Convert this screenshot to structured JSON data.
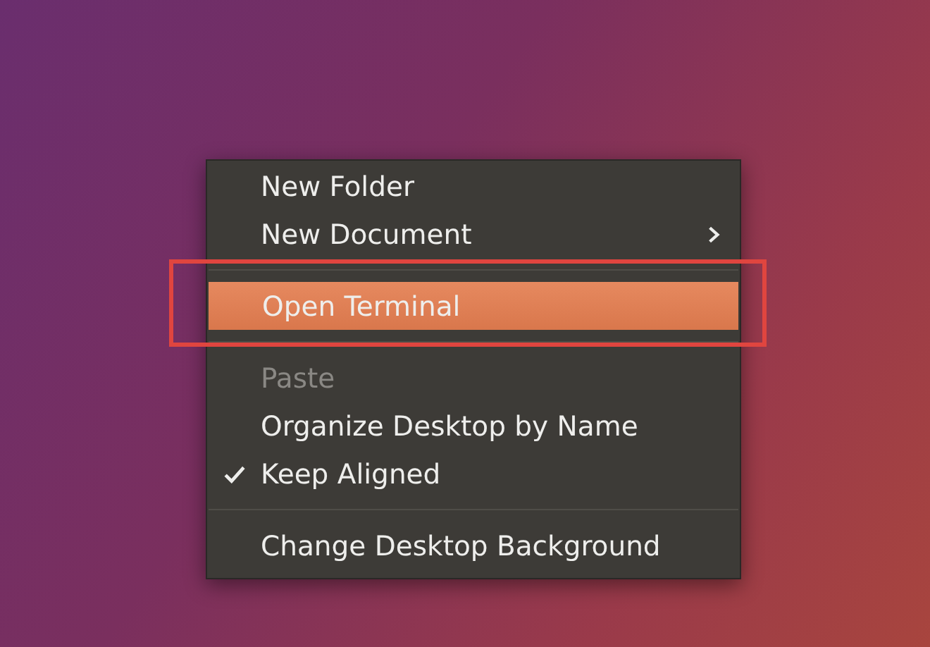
{
  "context_menu": {
    "items": [
      {
        "kind": "item",
        "label": "New Folder",
        "selected": false,
        "disabled": false,
        "checked": false,
        "submenu": false
      },
      {
        "kind": "item",
        "label": "New Document",
        "selected": false,
        "disabled": false,
        "checked": false,
        "submenu": true
      },
      {
        "kind": "separator"
      },
      {
        "kind": "item",
        "label": "Open Terminal",
        "selected": true,
        "disabled": false,
        "checked": false,
        "submenu": false
      },
      {
        "kind": "separator"
      },
      {
        "kind": "item",
        "label": "Paste",
        "selected": false,
        "disabled": true,
        "checked": false,
        "submenu": false
      },
      {
        "kind": "item",
        "label": "Organize Desktop by Name",
        "selected": false,
        "disabled": false,
        "checked": false,
        "submenu": false
      },
      {
        "kind": "item",
        "label": "Keep Aligned",
        "selected": false,
        "disabled": false,
        "checked": true,
        "submenu": false
      },
      {
        "kind": "separator"
      },
      {
        "kind": "item",
        "label": "Change Desktop Background",
        "selected": false,
        "disabled": false,
        "checked": false,
        "submenu": false
      }
    ]
  }
}
